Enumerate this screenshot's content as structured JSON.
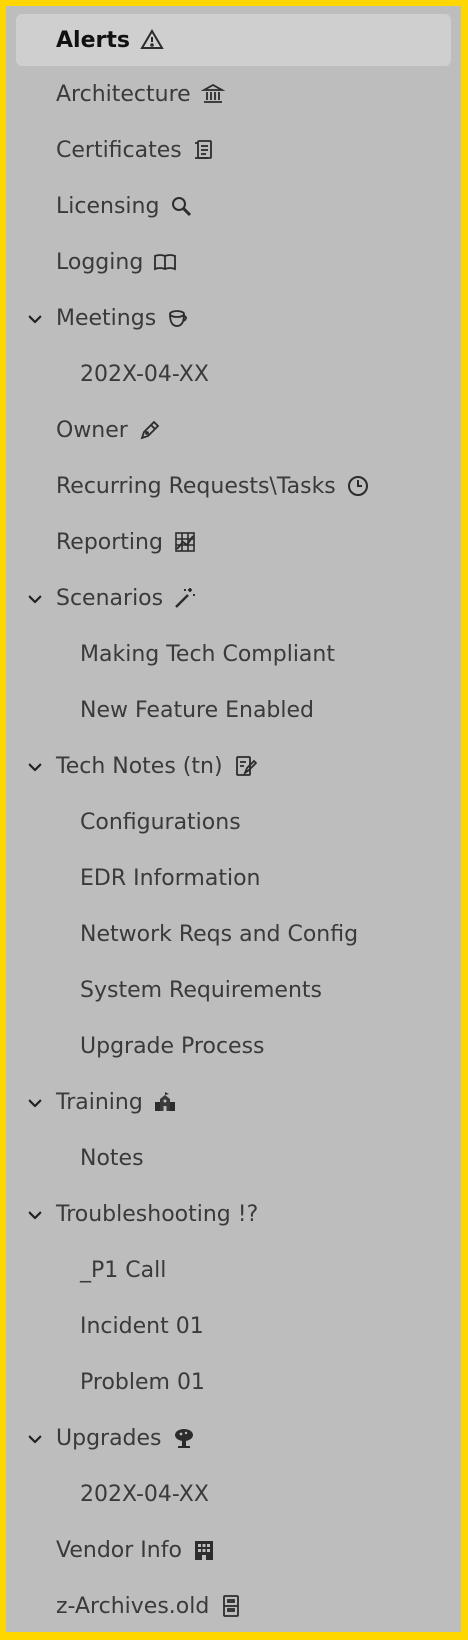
{
  "items": [
    {
      "label": "Alerts",
      "icon": "warning-icon",
      "level": 0,
      "selected": true
    },
    {
      "label": "Architecture",
      "icon": "classical-building-icon",
      "level": 0
    },
    {
      "label": "Certificates",
      "icon": "scroll-icon",
      "level": 0
    },
    {
      "label": "Licensing",
      "icon": "magnifier-icon",
      "level": 0
    },
    {
      "label": "Logging",
      "icon": "open-book-icon",
      "level": 0
    },
    {
      "label": "Meetings",
      "icon": "coffee-cup-icon",
      "level": 0,
      "expanded": true
    },
    {
      "label": "202X-04-XX",
      "level": 1
    },
    {
      "label": "Owner",
      "icon": "pen-icon",
      "level": 0
    },
    {
      "label": "Recurring Requests\\Tasks",
      "icon": "clock-icon",
      "level": 0
    },
    {
      "label": "Reporting",
      "icon": "chart-icon",
      "level": 0
    },
    {
      "label": "Scenarios",
      "icon": "magic-wand-icon",
      "level": 0,
      "expanded": true
    },
    {
      "label": "Making Tech Compliant",
      "level": 1
    },
    {
      "label": "New Feature Enabled",
      "level": 1
    },
    {
      "label": "Tech Notes (tn)",
      "icon": "memo-icon",
      "level": 0,
      "expanded": true
    },
    {
      "label": "Configurations",
      "level": 1
    },
    {
      "label": "EDR Information",
      "level": 1
    },
    {
      "label": "Network Reqs and Config",
      "level": 1
    },
    {
      "label": "System Requirements",
      "level": 1
    },
    {
      "label": "Upgrade Process",
      "level": 1
    },
    {
      "label": "Training",
      "icon": "school-icon",
      "level": 0,
      "expanded": true
    },
    {
      "label": "Notes",
      "level": 1
    },
    {
      "label": "Troubleshooting !?",
      "level": 0,
      "expanded": true
    },
    {
      "label": "_P1 Call",
      "level": 1
    },
    {
      "label": "Incident 01",
      "level": 1
    },
    {
      "label": "Problem 01",
      "level": 1
    },
    {
      "label": "Upgrades",
      "icon": "mushroom-cloud-icon",
      "level": 0,
      "expanded": true
    },
    {
      "label": "202X-04-XX",
      "level": 1
    },
    {
      "label": "Vendor Info",
      "icon": "office-building-icon",
      "level": 0
    },
    {
      "label": "z-Archives.old",
      "icon": "file-cabinet-icon",
      "level": 0
    }
  ]
}
